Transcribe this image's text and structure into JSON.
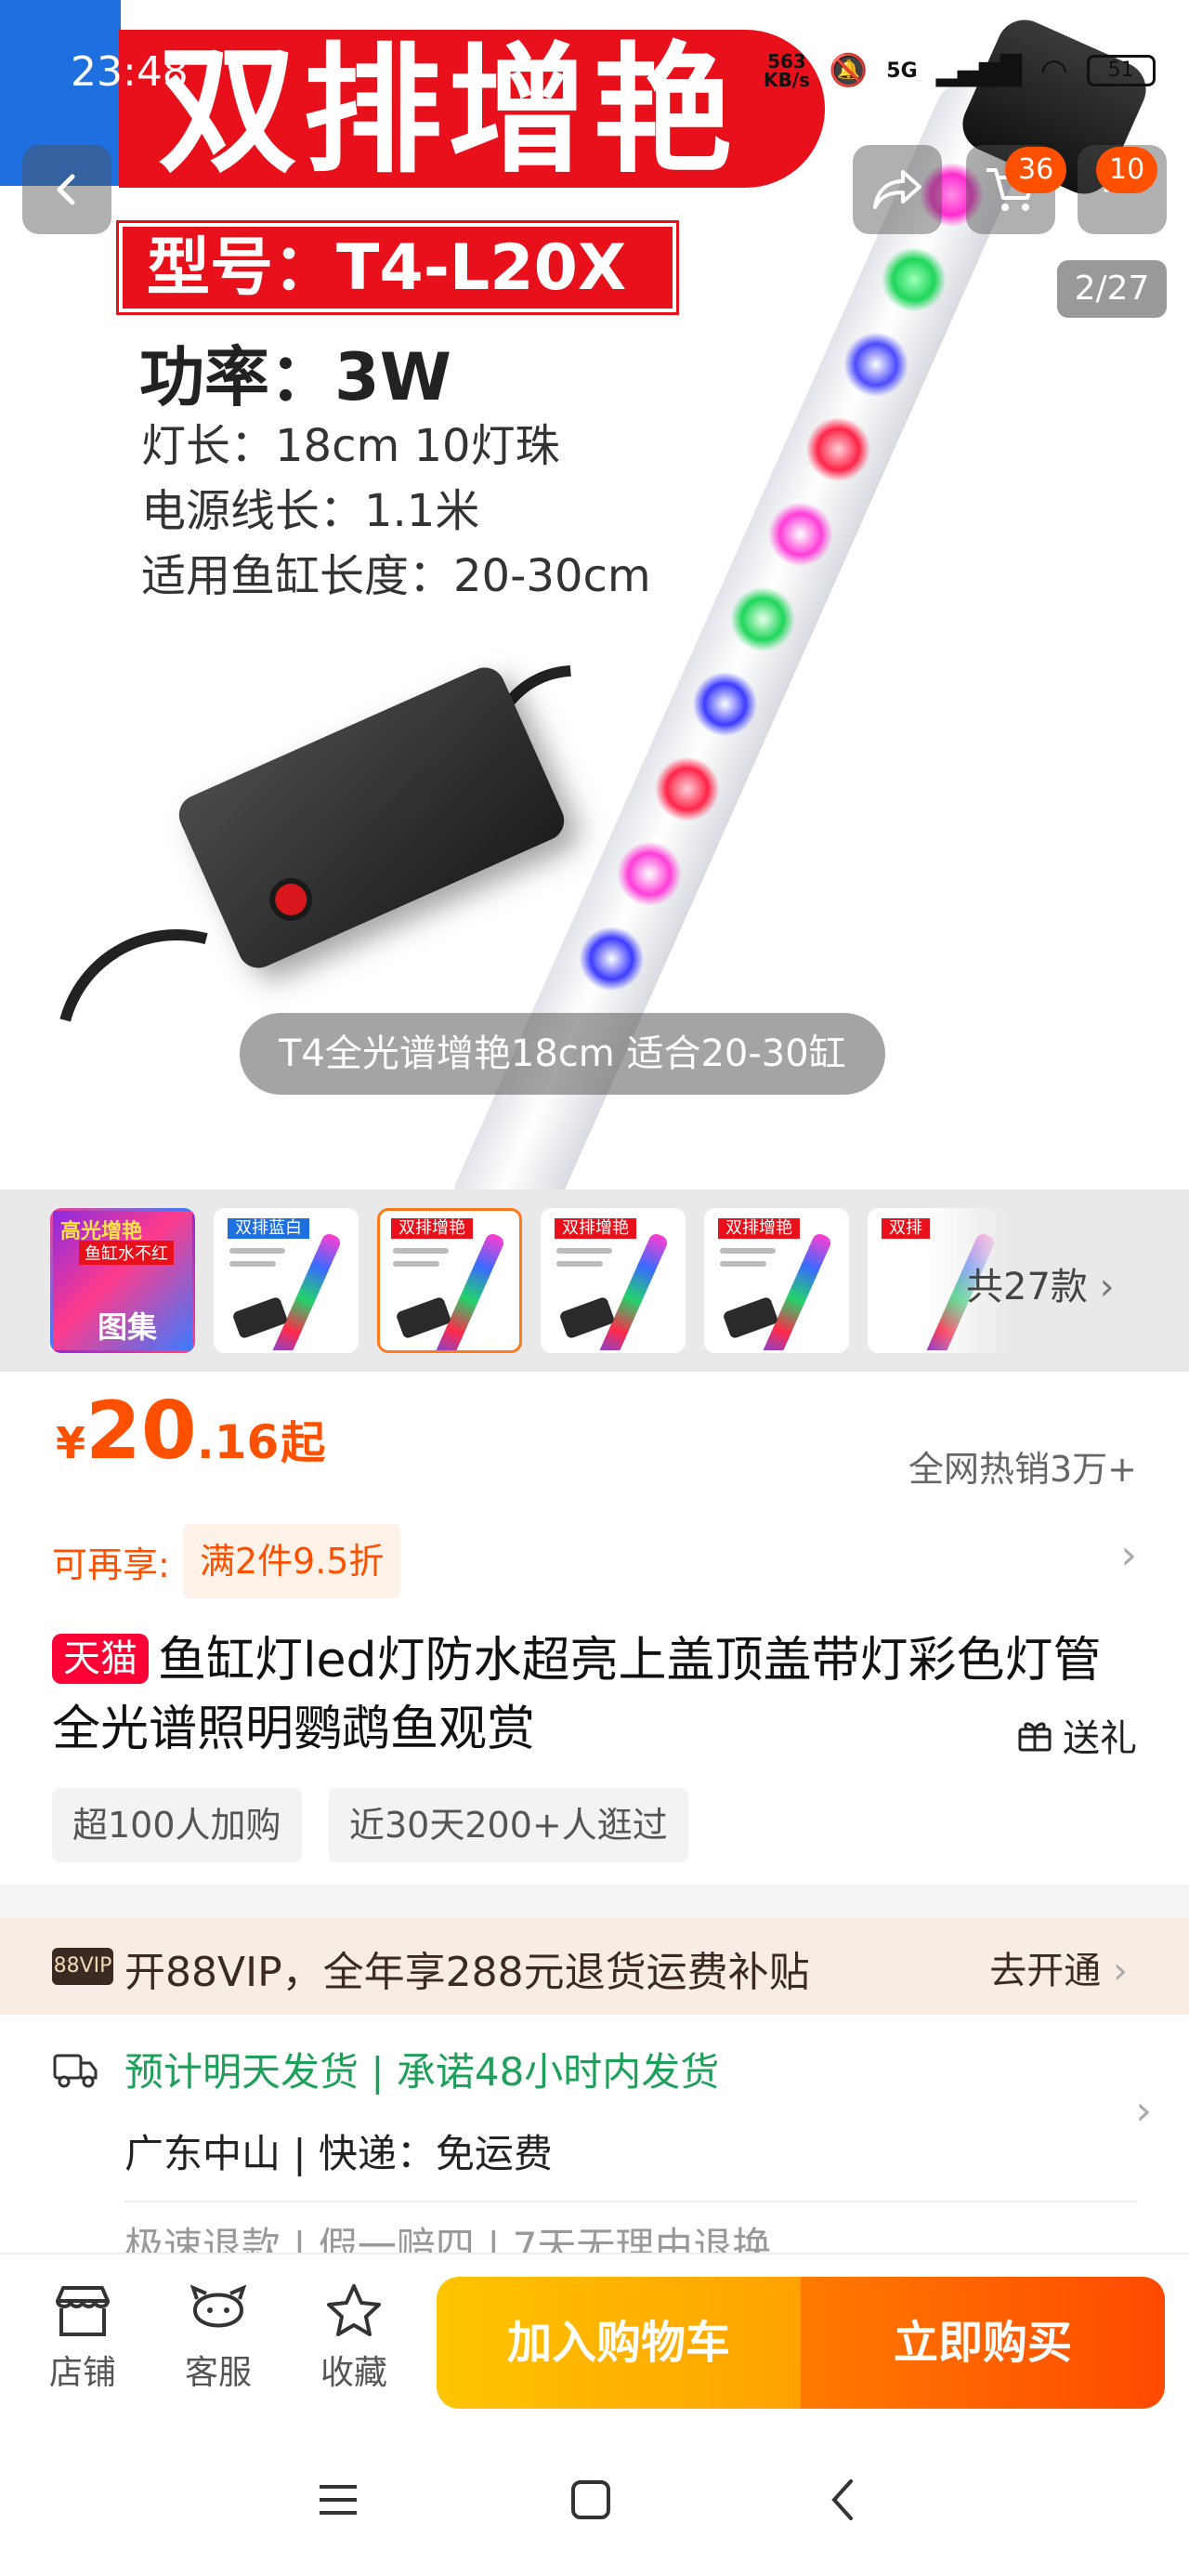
{
  "status_bar": {
    "time": "23:48",
    "net_speed_top": "563",
    "net_speed_bottom": "KB/s",
    "network": "5G",
    "battery": "51"
  },
  "hero": {
    "banner_title": "双排增艳",
    "model": "型号：T4-L20X",
    "power": "功率：3W",
    "spec_length": "灯长：18cm 10灯珠",
    "spec_cable": "电源线长：1.1米",
    "spec_tank": "适用鱼缸长度：20-30cm",
    "caption": "T4全光谱增艳18cm 适合20-30缸",
    "page_counter": "2/27",
    "cart_badge": "36",
    "more_badge": "10"
  },
  "thumbnails": {
    "gallery": {
      "top": "高光增艳",
      "sub": "鱼缸水不红",
      "label": "图集"
    },
    "items": [
      {
        "head": "双排蓝白",
        "model": "型号：T4-L20X",
        "color": "blue"
      },
      {
        "head": "双排增艳",
        "model": "型号：T4-L20X",
        "color": "red"
      },
      {
        "head": "双排增艳",
        "model": "型号：T4-L30X",
        "color": "red"
      },
      {
        "head": "双排增艳",
        "model": "型号：T4-L40X",
        "color": "red"
      },
      {
        "head": "双排",
        "model": "",
        "color": "red"
      }
    ],
    "more_label": "共27款"
  },
  "price": {
    "symbol": "¥",
    "integer": "20",
    "decimal": ".16",
    "suffix": "起",
    "hot_sales": "全网热销3万+"
  },
  "promo": {
    "label": "可再享:",
    "chip": "满2件9.5折"
  },
  "title": {
    "badge": "天猫",
    "text": "鱼缸灯led灯防水超亮上盖顶盖带灯彩色灯管全光谱照明鹦鹉鱼观赏",
    "gift": "送礼"
  },
  "tags": [
    "超100人加购",
    "近30天200+人逛过"
  ],
  "vip": {
    "badge": "88VIP",
    "text": "开88VIP，全年享288元退货运费补贴",
    "action": "去开通"
  },
  "shipping": {
    "line1": "预计明天发货 | 承诺48小时内发货",
    "line2": "广东中山 | 快递：免运费",
    "line3": "极速退款 | 假一赔四 | 7天无理由退换"
  },
  "actions": {
    "store": "店铺",
    "service": "客服",
    "favorite": "收藏",
    "add_cart": "加入购物车",
    "buy_now": "立即购买"
  },
  "colors": {
    "accent": "#ff5000",
    "banner_red": "#e8101a",
    "tmall": "#ff0036",
    "ship_green": "#1fa05a"
  }
}
